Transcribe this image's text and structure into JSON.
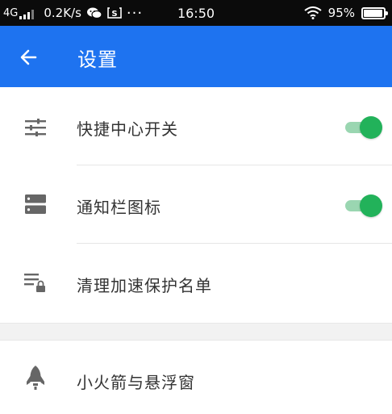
{
  "status_bar": {
    "network": "4G",
    "speed": "0.2K/s",
    "more": "···",
    "time": "16:50",
    "battery": "95%",
    "battery_level": 0.95,
    "icons": [
      "signal-icon",
      "wechat-icon",
      "s-box-icon",
      "wifi-icon",
      "battery-icon"
    ]
  },
  "app_bar": {
    "title": "设置",
    "back_icon": "back-arrow-icon",
    "color": "#1e73f0"
  },
  "settings": {
    "items": [
      {
        "label": "快捷中心开关",
        "icon": "sliders-icon",
        "toggle": true
      },
      {
        "label": "通知栏图标",
        "icon": "notification-bar-icon",
        "toggle": true
      },
      {
        "label": "清理加速保护名单",
        "icon": "list-lock-icon"
      },
      {
        "label": "小火箭与悬浮窗",
        "icon": "rocket-icon"
      }
    ],
    "toggle_on_color": "#22b25a"
  }
}
